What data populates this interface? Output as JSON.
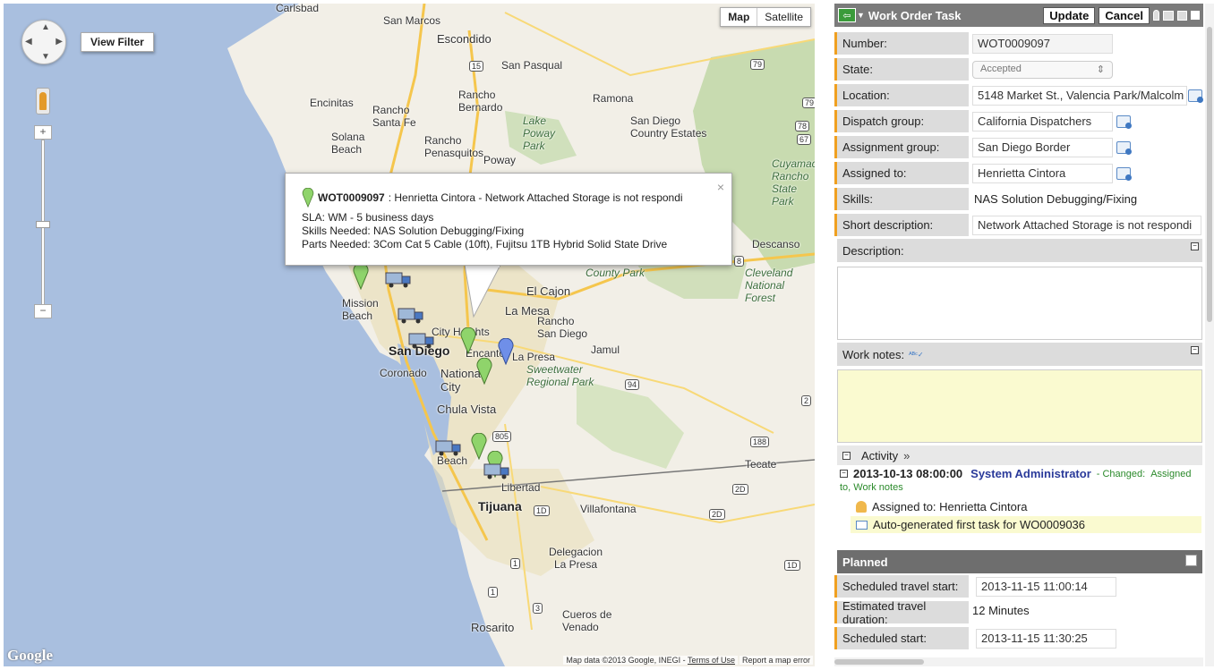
{
  "map": {
    "type_buttons": {
      "map": "Map",
      "satellite": "Satellite"
    },
    "view_filter_label": "View Filter",
    "labels": [
      {
        "text": "Carlsbad",
        "cls": ""
      },
      {
        "text": "San Marcos",
        "cls": ""
      },
      {
        "text": "Escondido",
        "cls": "med"
      },
      {
        "text": "San Pasqual",
        "cls": ""
      },
      {
        "text": "Encinitas",
        "cls": ""
      },
      {
        "text": "Rancho Bernardo",
        "cls": ""
      },
      {
        "text": "Ramona",
        "cls": ""
      },
      {
        "text": "Rancho Santa Fe",
        "cls": ""
      },
      {
        "text": "Solana Beach",
        "cls": ""
      },
      {
        "text": "Lake Poway Park",
        "cls": "it"
      },
      {
        "text": "San Diego Country Estates",
        "cls": ""
      },
      {
        "text": "Rancho Penasquitos",
        "cls": ""
      },
      {
        "text": "Poway",
        "cls": ""
      },
      {
        "text": "Cuyamaca Rancho State Park",
        "cls": "it"
      },
      {
        "text": "Descanso",
        "cls": ""
      },
      {
        "text": "Cleveland National Forest",
        "cls": "it"
      },
      {
        "text": "County Park",
        "cls": "it"
      },
      {
        "text": "El Cajon",
        "cls": "med"
      },
      {
        "text": "La Mesa",
        "cls": "med"
      },
      {
        "text": "Mission Beach",
        "cls": ""
      },
      {
        "text": "City Heights",
        "cls": ""
      },
      {
        "text": "Rancho San Diego",
        "cls": ""
      },
      {
        "text": "Jamul",
        "cls": ""
      },
      {
        "text": "San Diego",
        "cls": "big"
      },
      {
        "text": "Encanto",
        "cls": ""
      },
      {
        "text": "La Presa",
        "cls": ""
      },
      {
        "text": "Sweetwater Regional Park",
        "cls": "it"
      },
      {
        "text": "Coronado",
        "cls": ""
      },
      {
        "text": "National City",
        "cls": "med"
      },
      {
        "text": "Chula Vista",
        "cls": "med"
      },
      {
        "text": "Tecate",
        "cls": ""
      },
      {
        "text": "Libertad",
        "cls": ""
      },
      {
        "text": "Tijuana",
        "cls": "big"
      },
      {
        "text": "Villafontana",
        "cls": ""
      },
      {
        "text": "Delegacion La Presa",
        "cls": ""
      },
      {
        "text": "Cueros de Venado",
        "cls": ""
      },
      {
        "text": "Rosarito",
        "cls": "med"
      },
      {
        "text": "Beach",
        "cls": ""
      }
    ],
    "route_shields": [
      "79",
      "79",
      "67",
      "15",
      "94",
      "805",
      "188",
      "2D",
      "2D",
      "1",
      "1",
      "3",
      "2",
      "1D",
      "1D",
      "78",
      "8"
    ],
    "attribution": "Map data ©2013 Google, INEGI",
    "terms": "Terms of Use",
    "report": "Report a map error",
    "google": "Google",
    "infowindow": {
      "id": "WOT0009097",
      "title_rest": " : Henrietta Cintora - Network Attached Storage is not respondi",
      "sla": "SLA: WM - 5 business days",
      "skills": "Skills Needed: NAS Solution Debugging/Fixing",
      "parts": "Parts Needed: 3Com Cat 5 Cable (10ft), Fujitsu 1TB Hybrid Solid State Drive",
      "close": "×"
    },
    "colors": {
      "pin_green": "#8fd46b",
      "pin_blue": "#6f8fe8",
      "water": "#a9bfdf",
      "land": "#f2efe7",
      "park": "#c8dbb0"
    }
  },
  "form": {
    "title": "Work Order Task",
    "update_label": "Update",
    "cancel_label": "Cancel",
    "fields": {
      "number": {
        "label": "Number:",
        "value": "WOT0009097"
      },
      "state": {
        "label": "State:",
        "value": "Accepted"
      },
      "location": {
        "label": "Location:",
        "value": "5148 Market St., Valencia Park/Malcolm"
      },
      "dispatch_group": {
        "label": "Dispatch group:",
        "value": "California Dispatchers"
      },
      "assignment_group": {
        "label": "Assignment group:",
        "value": "San Diego Border"
      },
      "assigned_to": {
        "label": "Assigned to:",
        "value": "Henrietta Cintora"
      },
      "skills": {
        "label": "Skills:",
        "value": "NAS Solution Debugging/Fixing"
      },
      "short_description": {
        "label": "Short description:",
        "value": "Network Attached Storage is not respondi"
      }
    },
    "description_label": "Description:",
    "work_notes_label": "Work notes:",
    "activity": {
      "label": "Activity",
      "chevrons": "»",
      "entry_time": "2013-10-13 08:00:00",
      "entry_user": "System Administrator",
      "entry_changed": "- Changed:",
      "entry_fields_a": "Assigned",
      "entry_fields_b": "to, Work notes",
      "assigned_line": "Assigned to: Henrietta Cintora",
      "note_line": "Auto-generated first task for WO0009036"
    },
    "planned": {
      "title": "Planned",
      "travel_start": {
        "label": "Scheduled travel start:",
        "value": "2013-11-15 11:00:14"
      },
      "travel_duration": {
        "label": "Estimated travel duration:",
        "value": "12 Minutes"
      },
      "scheduled_start": {
        "label": "Scheduled start:",
        "value": "2013-11-15 11:30:25"
      }
    }
  }
}
